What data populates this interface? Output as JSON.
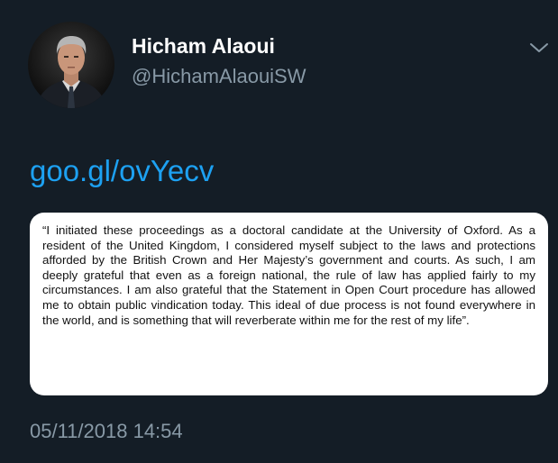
{
  "author": {
    "display_name": "Hicham Alaoui",
    "handle": "@HichamAlaouiSW",
    "avatar_icon": "profile-photo"
  },
  "header": {
    "menu_icon": "chevron-down-icon"
  },
  "tweet": {
    "link_text": "goo.gl/ovYecv",
    "quote_text": "“I initiated these proceedings as a doctoral candidate at the University of Oxford. As a resident of the United Kingdom, I considered myself subject to the laws and protections afforded by the British Crown and Her Majesty’s government and courts. As such, I am deeply grateful that even as a foreign national, the rule of law has applied fairly to my circumstances. I am also grateful that the Statement in Open Court procedure has allowed me to obtain public vindication today. This ideal of due process is not found everywhere in the world, and is something that will reverberate within me for the rest of my life”.",
    "timestamp": "05/11/2018 14:54"
  },
  "colors": {
    "background": "#141d26",
    "link": "#1da1f2",
    "secondary_text": "#8899a6",
    "primary_text": "#ffffff"
  }
}
